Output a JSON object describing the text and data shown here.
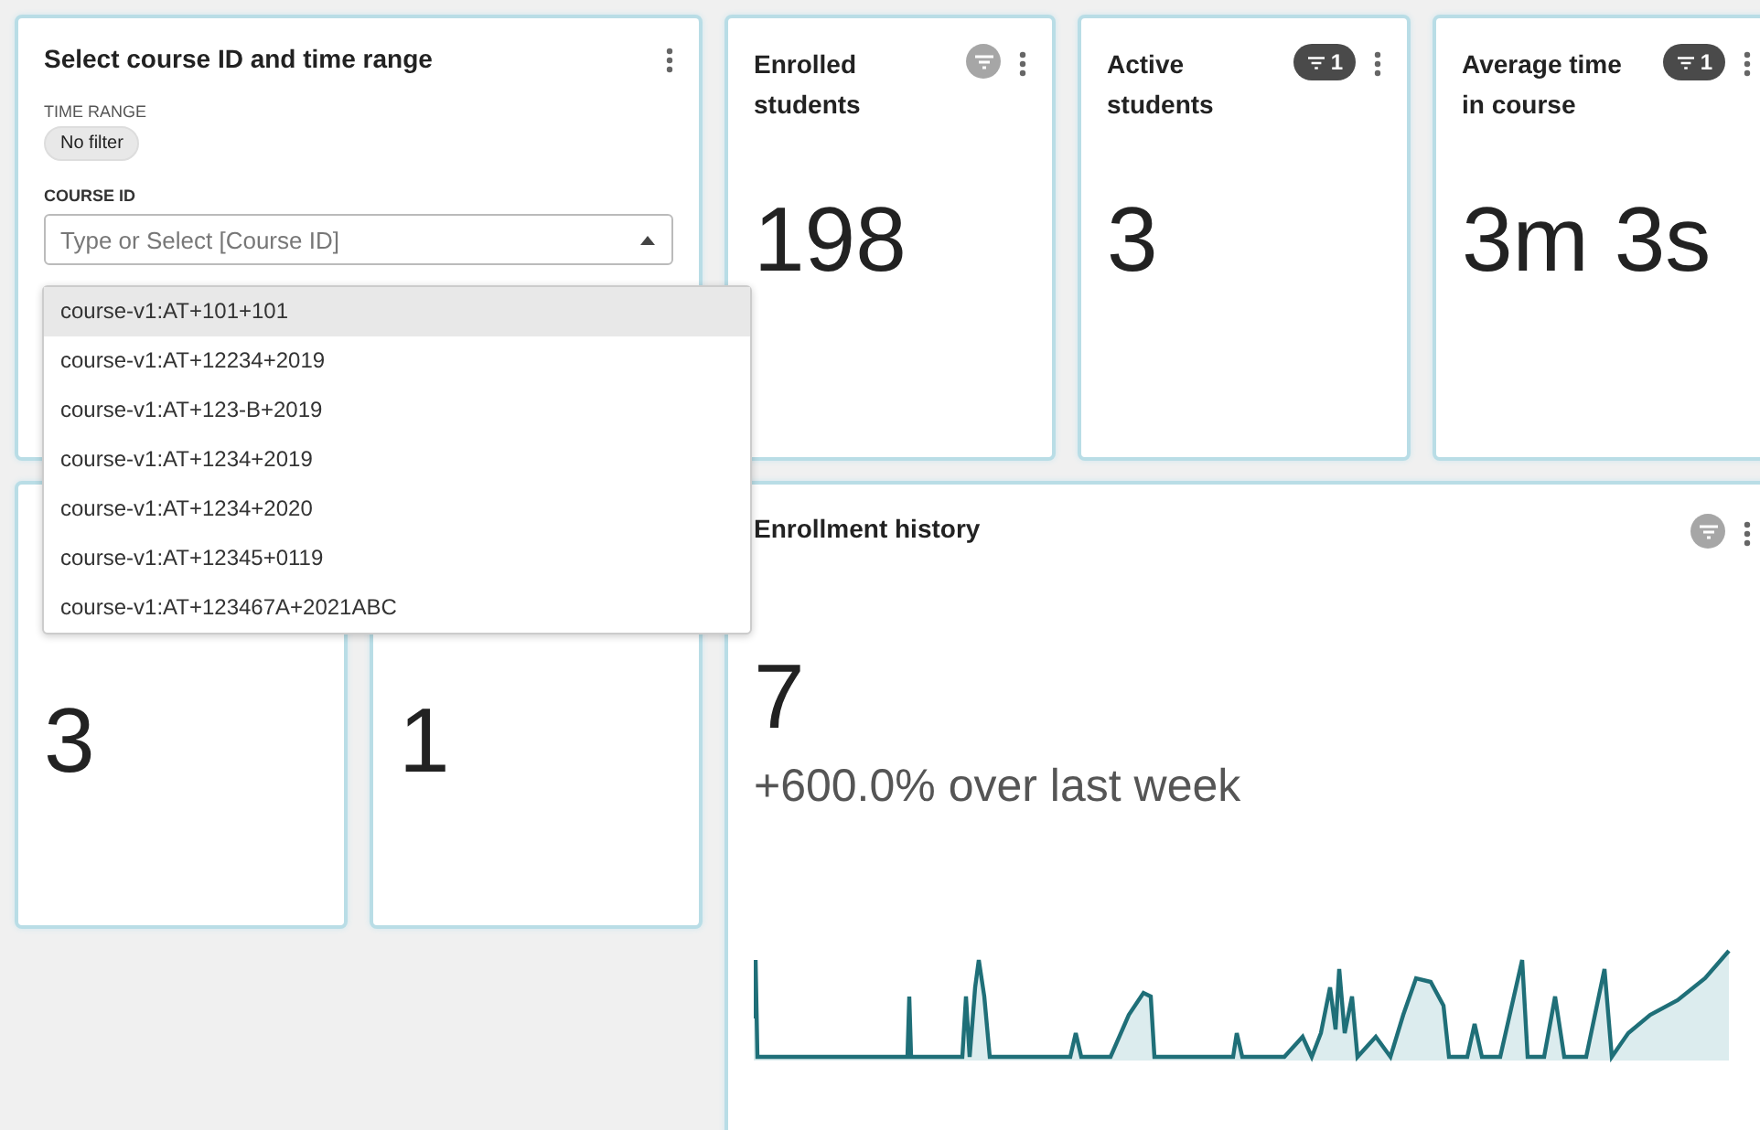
{
  "selector": {
    "title": "Select course ID and time range",
    "time_range": {
      "label": "TIME RANGE",
      "chip": "No filter"
    },
    "course_id": {
      "label": "COURSE ID",
      "placeholder": "Type or Select [Course ID]",
      "expanded": true,
      "options": [
        {
          "label": "course-v1:AT+101+101",
          "selected": true
        },
        {
          "label": "course-v1:AT+12234+2019",
          "selected": false
        },
        {
          "label": "course-v1:AT+123-B+2019",
          "selected": false
        },
        {
          "label": "course-v1:AT+1234+2019",
          "selected": false
        },
        {
          "label": "course-v1:AT+1234+2020",
          "selected": false
        },
        {
          "label": "course-v1:AT+12345+0119",
          "selected": false
        },
        {
          "label": "course-v1:AT+123467A+2021ABC",
          "selected": false
        }
      ]
    }
  },
  "kpis": [
    {
      "title": "Enrolled students",
      "filter": {
        "kind": "dot"
      },
      "value": "198"
    },
    {
      "title": "Active students",
      "filter": {
        "kind": "count",
        "count": "1"
      },
      "value": "3"
    },
    {
      "title": "Average time in course",
      "filter": {
        "kind": "count",
        "count": "1"
      },
      "value": "3m 3s"
    }
  ],
  "lower_kpis": [
    {
      "value": "3"
    },
    {
      "value": "1"
    }
  ],
  "history": {
    "title": "Enrollment history",
    "filter": {
      "kind": "dot"
    },
    "value": "7",
    "change": "+600.0% over last week"
  }
}
